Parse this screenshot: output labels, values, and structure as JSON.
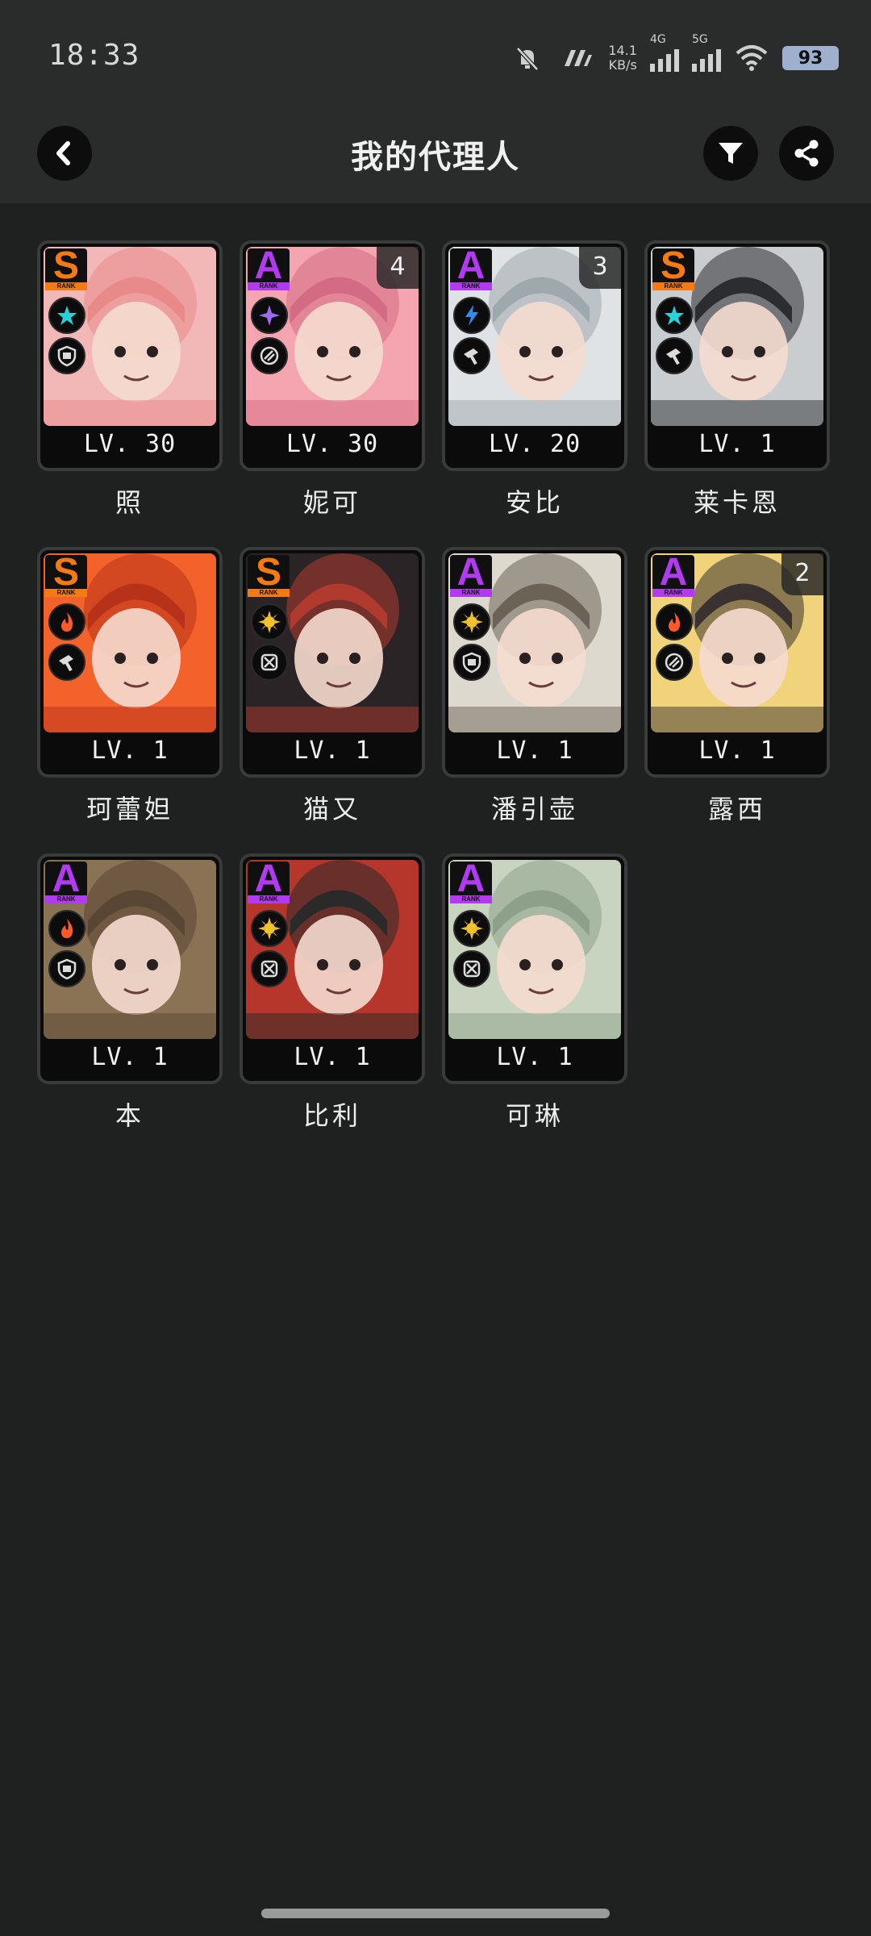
{
  "status_bar": {
    "time": "18:33",
    "net_speed_value": "14.1",
    "net_speed_unit": "KB/s",
    "signal_1_label": "4G",
    "signal_2_label": "5G",
    "battery": "93",
    "icons": [
      "mute-bell-icon",
      "vibrate-icon",
      "signal-4g-icon",
      "signal-5g-icon",
      "wifi-icon",
      "battery-icon"
    ]
  },
  "header": {
    "title": "我的代理人",
    "back_icon": "chevron-left-icon",
    "filter_icon": "filter-icon",
    "share_icon": "share-icon"
  },
  "colors": {
    "rank_s": "#f47a14",
    "rank_a": "#b13bf0",
    "ether": "#27d3d8",
    "electric": "#2f8cf0",
    "physical": "#f2c12e",
    "fire": "#ff5a2a",
    "ice": "#9b6cf0"
  },
  "agents": [
    {
      "name": "照",
      "level": "LV. 30",
      "rank": "S",
      "rank_sub": "RANK",
      "element": "ether",
      "role": "defense",
      "dupe": "",
      "art_bg": "#f2b7b7",
      "art_accent": "#e98a8a"
    },
    {
      "name": "妮可",
      "level": "LV. 30",
      "rank": "A",
      "rank_sub": "RANK",
      "element": "ether-sparkle",
      "role": "support",
      "dupe": "4",
      "art_bg": "#f4a5b0",
      "art_accent": "#d46b84"
    },
    {
      "name": "安比",
      "level": "LV. 20",
      "rank": "A",
      "rank_sub": "RANK",
      "element": "electric",
      "role": "stun",
      "dupe": "3",
      "art_bg": "#dfe3e5",
      "art_accent": "#9fa8ad"
    },
    {
      "name": "莱卡恩",
      "level": "LV. 1",
      "rank": "S",
      "rank_sub": "RANK",
      "element": "ice",
      "role": "stun",
      "dupe": "",
      "art_bg": "#c9cdd0",
      "art_accent": "#2b2d30"
    },
    {
      "name": "珂蕾妲",
      "level": "LV. 1",
      "rank": "S",
      "rank_sub": "RANK",
      "element": "fire",
      "role": "stun",
      "dupe": "",
      "art_bg": "#f4622c",
      "art_accent": "#b8321a"
    },
    {
      "name": "猫又",
      "level": "LV. 1",
      "rank": "S",
      "rank_sub": "RANK",
      "element": "physical",
      "role": "attack",
      "dupe": "",
      "art_bg": "#2a2427",
      "art_accent": "#b13a2e"
    },
    {
      "name": "潘引壶",
      "level": "LV. 1",
      "rank": "A",
      "rank_sub": "RANK",
      "element": "physical",
      "role": "defense",
      "dupe": "",
      "art_bg": "#ded9cf",
      "art_accent": "#6b6355"
    },
    {
      "name": "露西",
      "level": "LV. 1",
      "rank": "A",
      "rank_sub": "RANK",
      "element": "fire",
      "role": "support",
      "dupe": "2",
      "art_bg": "#f0d37a",
      "art_accent": "#3a3130"
    },
    {
      "name": "本",
      "level": "LV. 1",
      "rank": "A",
      "rank_sub": "RANK",
      "element": "fire",
      "role": "defense",
      "dupe": "",
      "art_bg": "#8a7254",
      "art_accent": "#5a4634"
    },
    {
      "name": "比利",
      "level": "LV. 1",
      "rank": "A",
      "rank_sub": "RANK",
      "element": "physical",
      "role": "attack",
      "dupe": "",
      "art_bg": "#b7362b",
      "art_accent": "#2a2a2a"
    },
    {
      "name": "可琳",
      "level": "LV. 1",
      "rank": "A",
      "rank_sub": "RANK",
      "element": "physical",
      "role": "attack",
      "dupe": "",
      "art_bg": "#c8d4bf",
      "art_accent": "#8ea08a"
    }
  ]
}
